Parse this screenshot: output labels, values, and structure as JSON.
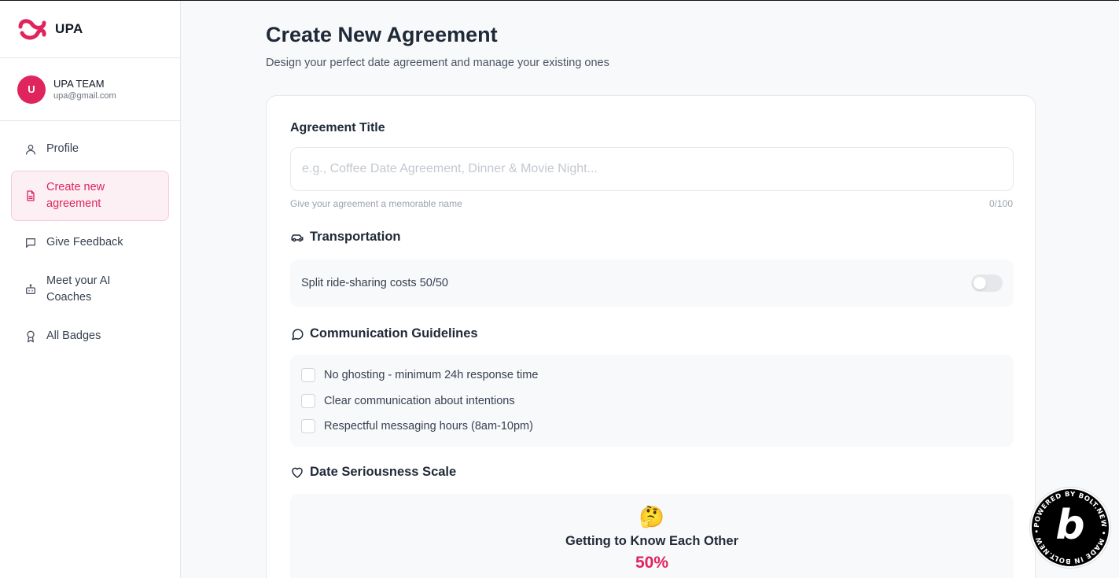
{
  "brand": {
    "name": "UPA",
    "logo_color": "#e0245e"
  },
  "user": {
    "initial": "U",
    "name": "UPA TEAM",
    "email": "upa@gmail.com"
  },
  "nav": [
    {
      "label": "Profile",
      "icon": "user-icon"
    },
    {
      "label": "Create new agreement",
      "icon": "document-icon",
      "active": true
    },
    {
      "label": "Give Feedback",
      "icon": "message-square-icon"
    },
    {
      "label": "Meet your AI Coaches",
      "icon": "bot-icon"
    },
    {
      "label": "All Badges",
      "icon": "award-icon"
    }
  ],
  "page": {
    "title": "Create New Agreement",
    "subtitle": "Design your perfect date agreement and manage your existing ones"
  },
  "form": {
    "title_label": "Agreement Title",
    "title_placeholder": "e.g., Coffee Date Agreement, Dinner & Movie Night...",
    "title_value": "",
    "title_hint": "Give your agreement a memorable name",
    "title_counter": "0/100",
    "transportation": {
      "heading": "Transportation",
      "icon": "car-icon",
      "option": "Split ride-sharing costs 50/50",
      "enabled": false
    },
    "communication": {
      "heading": "Communication Guidelines",
      "icon": "message-circle-icon",
      "options": [
        "No ghosting - minimum 24h response time",
        "Clear communication about intentions",
        "Respectful messaging hours (8am-10pm)"
      ]
    },
    "seriousness": {
      "heading": "Date Seriousness Scale",
      "icon": "heart-icon",
      "emoji": "🤔",
      "level_title": "Getting to Know Each Other",
      "value_text": "50%",
      "value": 0.5
    }
  },
  "colors": {
    "accent": "#e0245e",
    "active_bg": "#fdf0f4"
  }
}
